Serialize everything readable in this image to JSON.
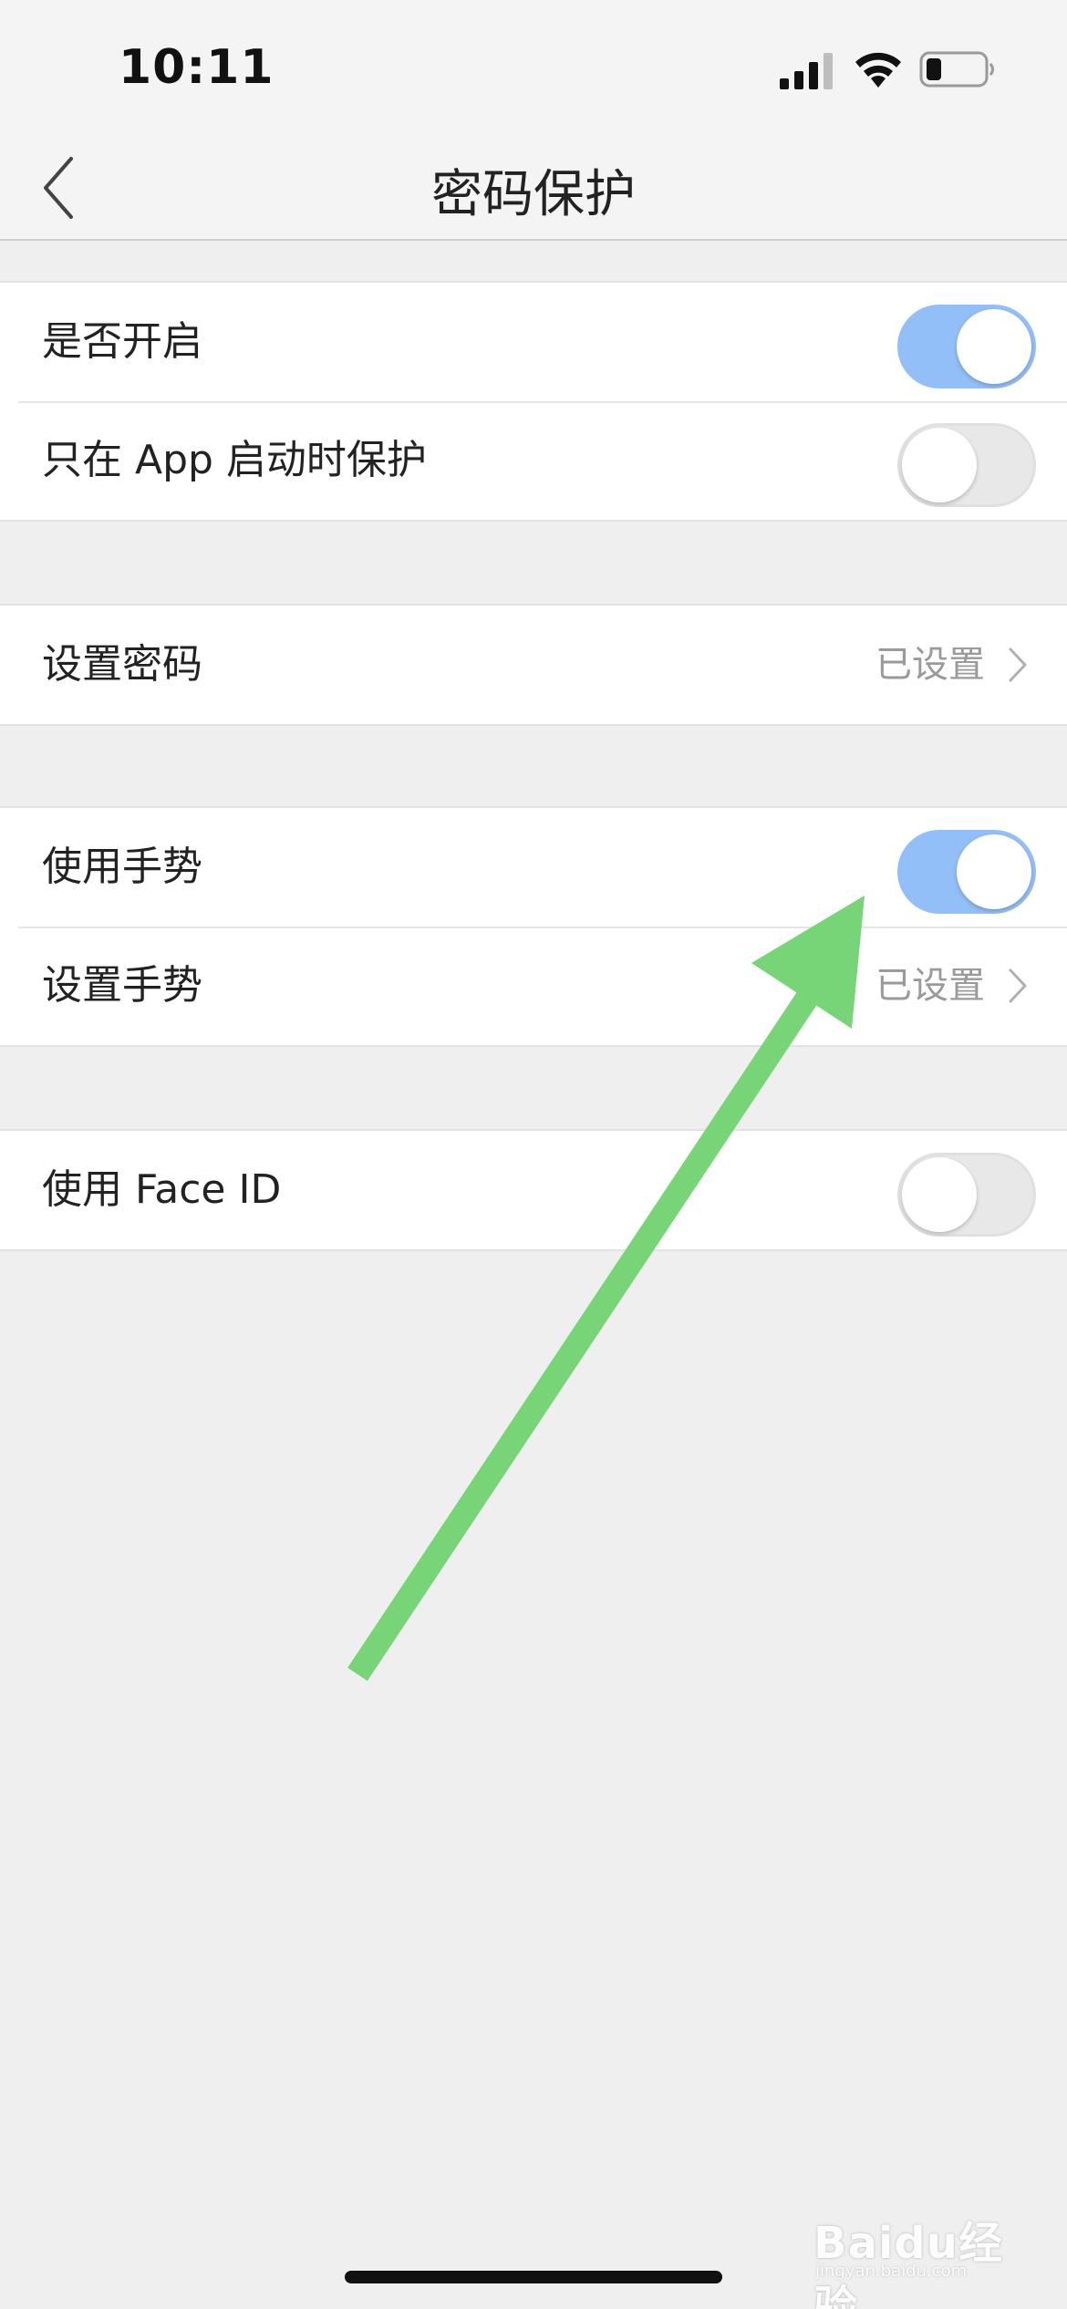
{
  "status_bar": {
    "time": "10:11",
    "icons": [
      "signal-icon",
      "wifi-icon",
      "battery-icon"
    ]
  },
  "nav": {
    "title": "密码保护",
    "back_icon": "back-chevron-icon"
  },
  "groups": [
    {
      "rows": [
        {
          "label": "是否开启",
          "control": "toggle",
          "on": true
        },
        {
          "label": "只在 App 启动时保护",
          "control": "toggle",
          "on": false
        }
      ]
    },
    {
      "rows": [
        {
          "label": "设置密码",
          "value": "已设置",
          "control": "chevron"
        }
      ]
    },
    {
      "rows": [
        {
          "label": "使用手势",
          "control": "toggle",
          "on": true
        },
        {
          "label": "设置手势",
          "value": "已设置",
          "control": "chevron"
        }
      ]
    },
    {
      "rows": [
        {
          "label": "使用 Face ID",
          "control": "toggle",
          "on": false
        }
      ]
    }
  ],
  "watermark": {
    "text": "Baidu经验",
    "sub": "jingyan.baidu.com"
  },
  "colors": {
    "toggle_on": "#93bff8",
    "toggle_off": "#e8e8e8",
    "arrow": "#77d577",
    "background": "#efefef"
  }
}
